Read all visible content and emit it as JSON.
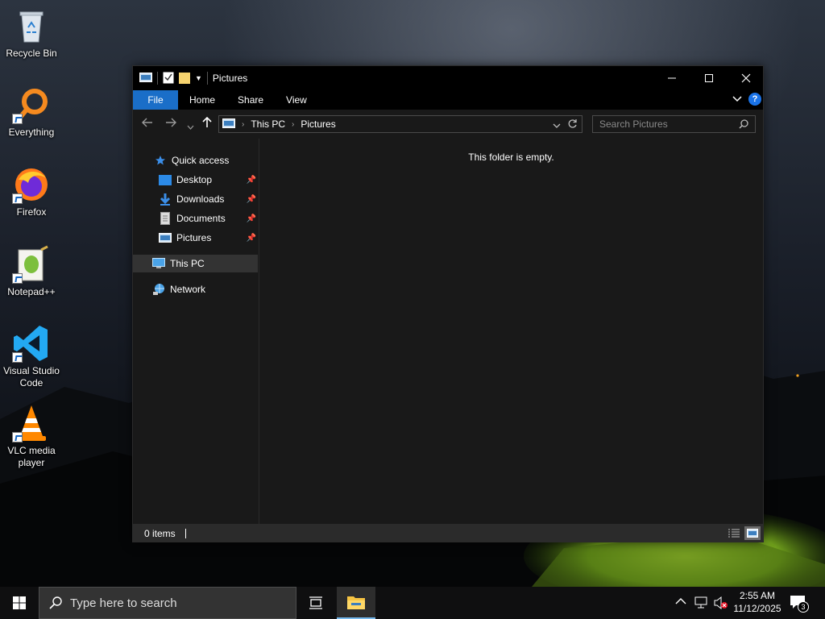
{
  "desktop": {
    "icons": [
      {
        "label": "Recycle Bin",
        "icon": "recycle-bin-icon"
      },
      {
        "label": "Everything",
        "icon": "everything-search-icon"
      },
      {
        "label": "Firefox",
        "icon": "firefox-icon"
      },
      {
        "label": "Notepad++",
        "icon": "notepad-plus-plus-icon"
      },
      {
        "label": "Visual Studio Code",
        "icon": "vscode-icon"
      },
      {
        "label": "VLC media player",
        "icon": "vlc-icon"
      }
    ]
  },
  "window": {
    "title": "Pictures",
    "ribbon_tabs": {
      "file": "File",
      "home": "Home",
      "share": "Share",
      "view": "View"
    },
    "address": {
      "root": "This PC",
      "current": "Pictures"
    },
    "search": {
      "placeholder": "Search Pictures"
    },
    "nav": {
      "quick_access": "Quick access",
      "desktop": "Desktop",
      "downloads": "Downloads",
      "documents": "Documents",
      "pictures": "Pictures",
      "this_pc": "This PC",
      "network": "Network"
    },
    "empty_message": "This folder is empty.",
    "status": {
      "item_count": "0 items"
    }
  },
  "taskbar": {
    "search_placeholder": "Type here to search",
    "time": "2:55 AM",
    "date": "11/12/2025",
    "notification_count": "3"
  },
  "colors": {
    "accent": "#1a6ec8",
    "window_bg": "#191919",
    "taskbar_bg": "#0f0f10"
  }
}
